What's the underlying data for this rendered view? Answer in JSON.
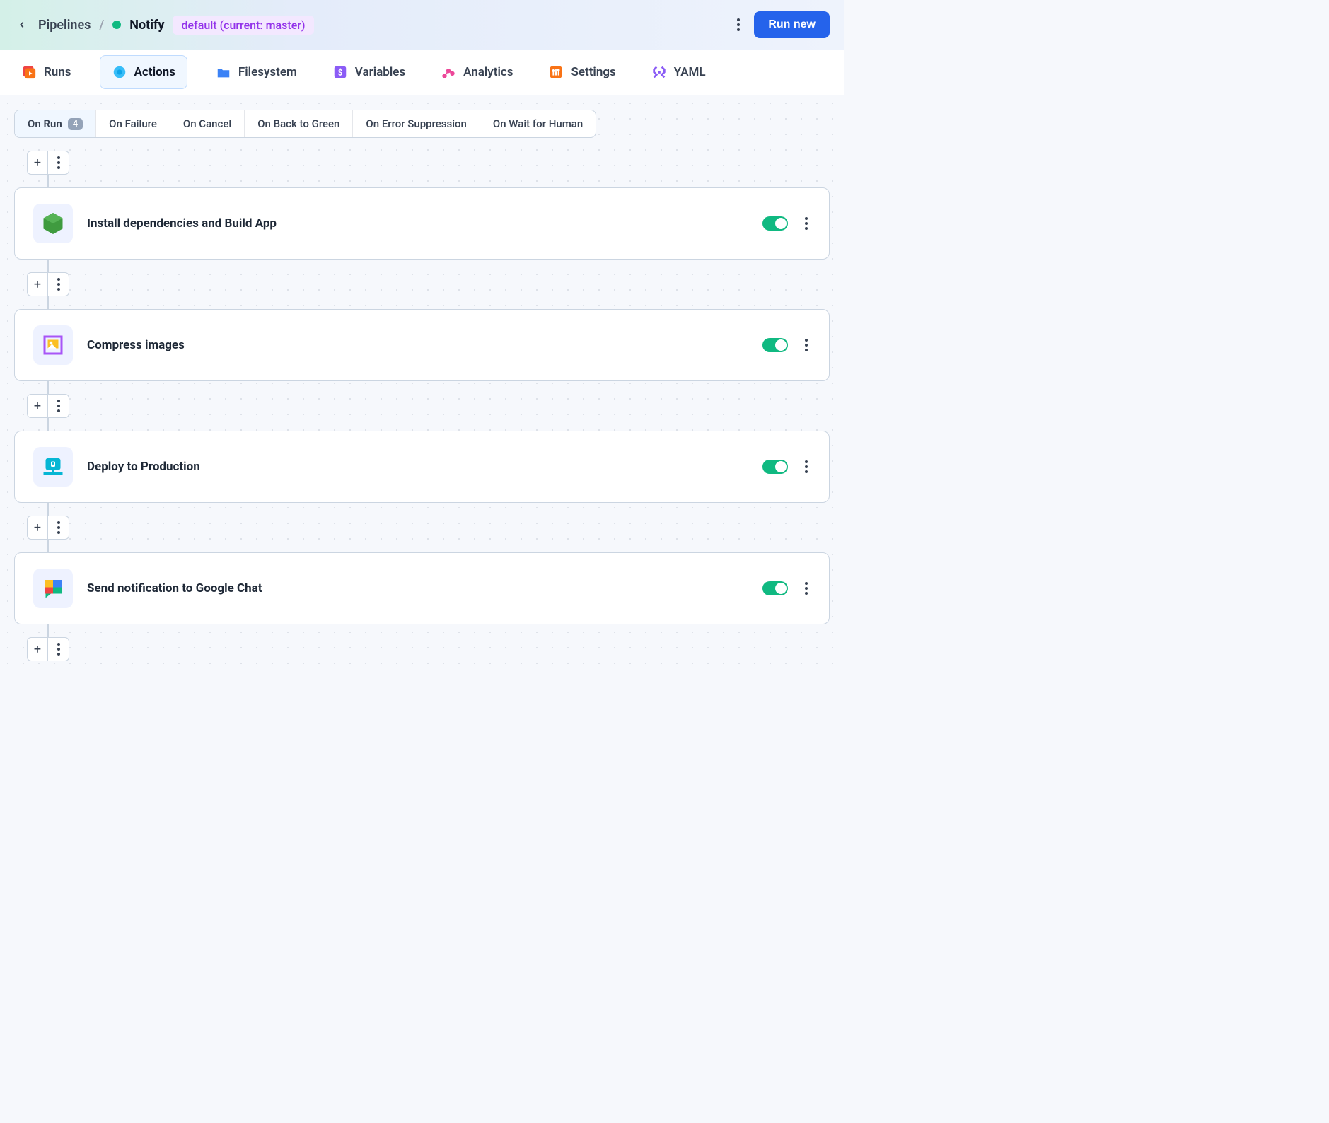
{
  "header": {
    "breadcrumb_root": "Pipelines",
    "pipeline_name": "Notify",
    "branch_badge": "default (current: master)",
    "run_new_label": "Run new"
  },
  "tabs": {
    "runs": "Runs",
    "actions": "Actions",
    "filesystem": "Filesystem",
    "variables": "Variables",
    "analytics": "Analytics",
    "settings": "Settings",
    "yaml": "YAML",
    "active": "actions"
  },
  "triggers": {
    "on_run": {
      "label": "On Run",
      "count": "4"
    },
    "on_failure": "On Failure",
    "on_cancel": "On Cancel",
    "on_back_to_green": "On Back to Green",
    "on_error_suppression": "On Error Suppression",
    "on_wait_for_human": "On Wait for Human",
    "active": "on_run"
  },
  "actions": [
    {
      "label": "Install dependencies and Build App",
      "icon": "node",
      "enabled": true
    },
    {
      "label": "Compress images",
      "icon": "compress",
      "enabled": true
    },
    {
      "label": "Deploy to Production",
      "icon": "deploy",
      "enabled": true
    },
    {
      "label": "Send notification to Google Chat",
      "icon": "google-chat",
      "enabled": true
    }
  ]
}
